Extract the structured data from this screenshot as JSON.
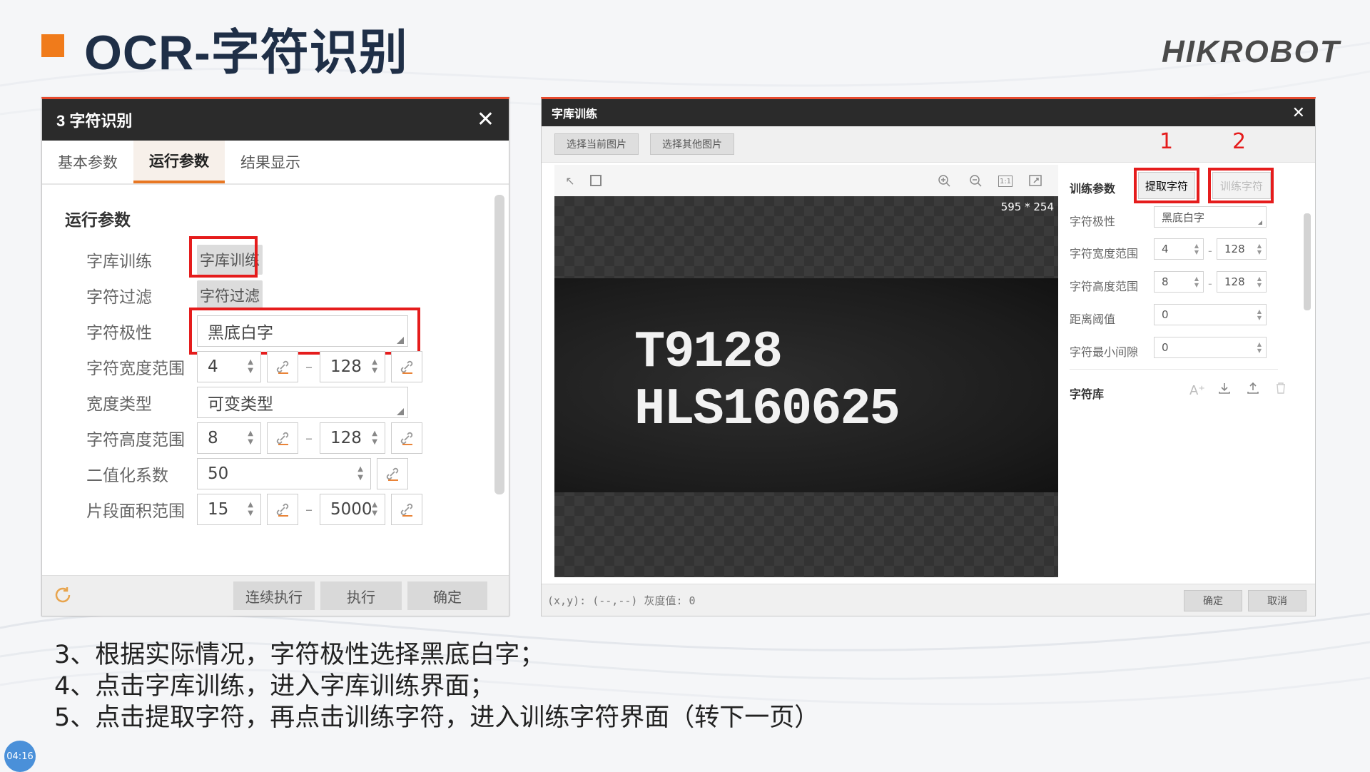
{
  "slide": {
    "title": "OCR-字符识别",
    "logo": "HIKROBOT",
    "accent_color": "#f07b1b",
    "notes": [
      "3、根据实际情况，字符极性选择黑底白字；",
      "4、点击字库训练，进入字库训练界面；",
      "5、点击提取字符，再点击训练字符，进入训练字符界面（转下一页）"
    ],
    "clock": "04:16"
  },
  "left_panel": {
    "title": "3 字符识别",
    "close": "✕",
    "tabs": [
      "基本参数",
      "运行参数",
      "结果显示"
    ],
    "section": "运行参数",
    "rows": {
      "library_train": {
        "label": "字库训练",
        "button": "字库训练"
      },
      "char_filter": {
        "label": "字符过滤",
        "button": "字符过滤"
      },
      "polarity": {
        "label": "字符极性",
        "value": "黑底白字"
      },
      "width_range": {
        "label": "字符宽度范围",
        "min": "4",
        "max": "128"
      },
      "width_type": {
        "label": "宽度类型",
        "value": "可变类型"
      },
      "height_range": {
        "label": "字符高度范围",
        "min": "8",
        "max": "128"
      },
      "binarize": {
        "label": "二值化系数",
        "value": "50"
      },
      "area_range": {
        "label": "片段面积范围",
        "min": "15",
        "max": "5000"
      }
    },
    "footer": {
      "continuous": "连续执行",
      "run": "执行",
      "ok": "确定"
    }
  },
  "right_panel": {
    "title": "字库训练",
    "close": "✕",
    "select_current": "选择当前图片",
    "select_other": "选择其他图片",
    "image_size": "595 * 254",
    "ocr_line1": "T9128",
    "ocr_line2": "HLS160625",
    "marker1": "1",
    "marker2": "2",
    "params_title": "训练参数",
    "extract_button": "提取字符",
    "train_button": "训练字符",
    "polarity": {
      "label": "字符极性",
      "value": "黑底白字"
    },
    "width_range": {
      "label": "字符宽度范围",
      "min": "4",
      "max": "128"
    },
    "height_range": {
      "label": "字符高度范围",
      "min": "8",
      "max": "128"
    },
    "distance": {
      "label": "距离阈值",
      "value": "0"
    },
    "min_gap": {
      "label": "字符最小间隙",
      "value": "0"
    },
    "library": "字符库",
    "coord": "(x,y): (--,--) 灰度值: 0",
    "ok": "确定",
    "cancel": "取消"
  }
}
